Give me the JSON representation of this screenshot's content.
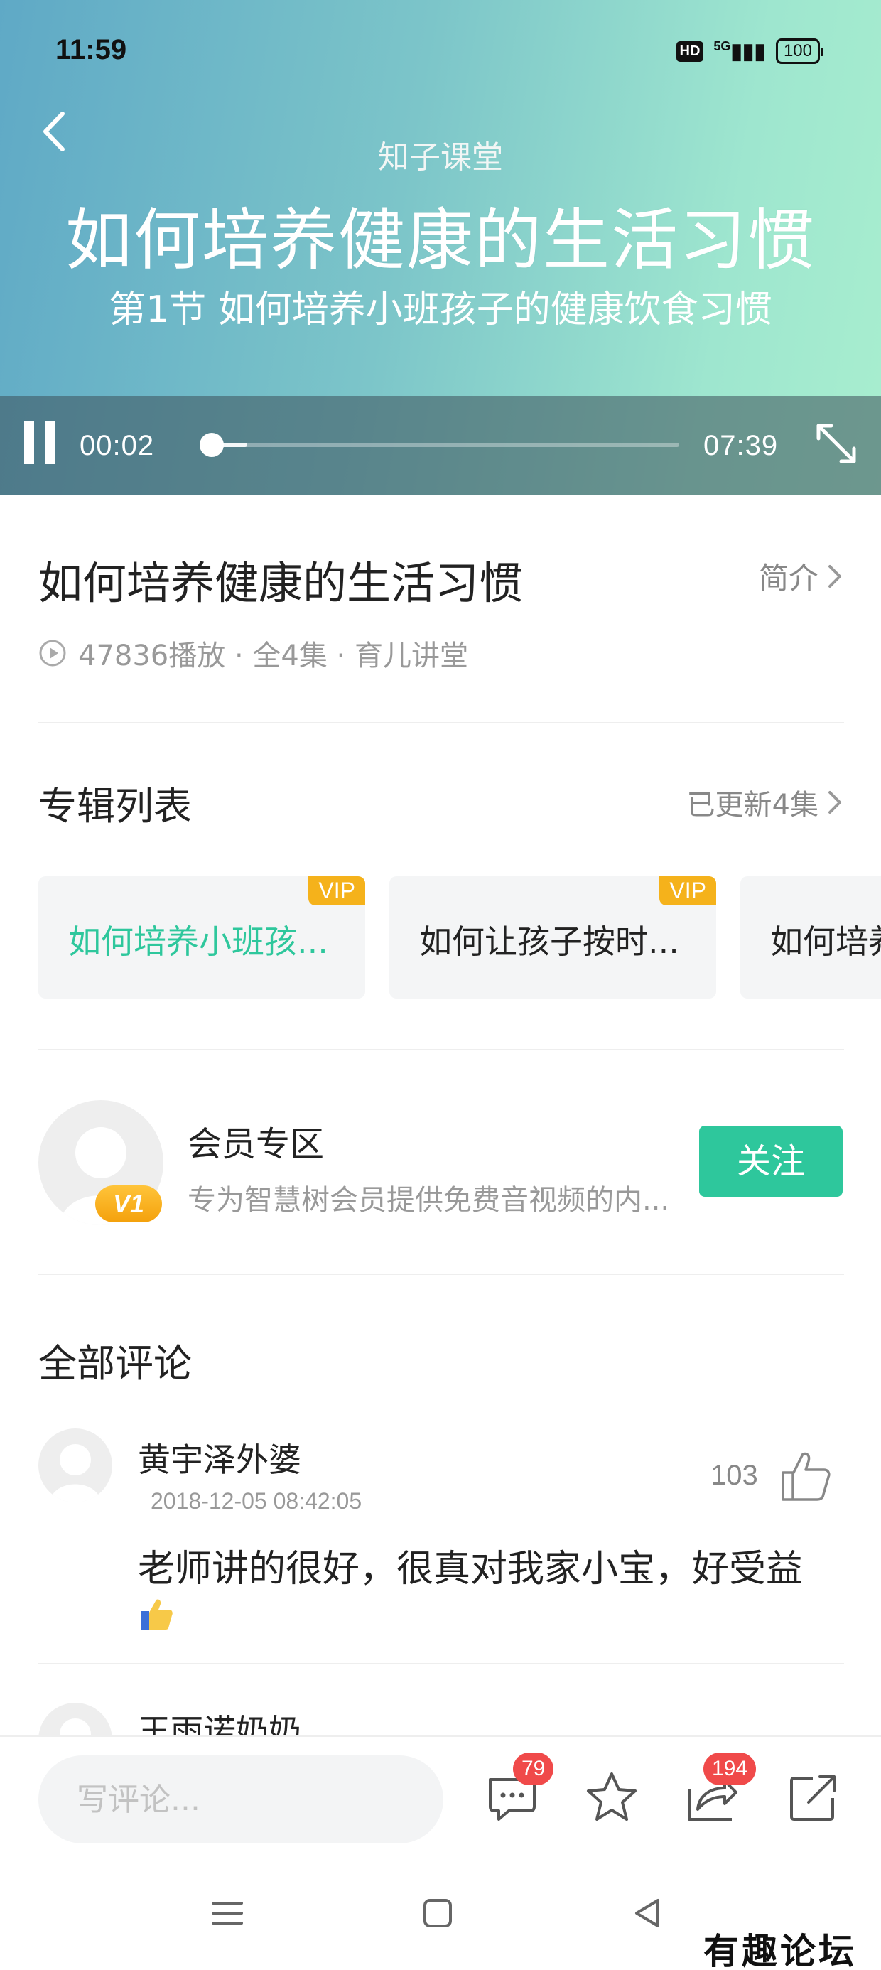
{
  "status_bar": {
    "time": "11:59",
    "hd": "HD",
    "network": "5G",
    "battery": "100"
  },
  "video": {
    "brand": "知子课堂",
    "title": "如何培养健康的生活习惯",
    "subtitle": "第1节 如何培养小班孩子的健康饮食习惯",
    "current_time": "00:02",
    "duration": "07:39",
    "progress_fraction": 0.004,
    "buffered_fraction": 0.09
  },
  "album": {
    "title": "如何培养健康的生活习惯",
    "intro_label": "简介",
    "meta": "47836播放 · 全4集 · 育儿讲堂"
  },
  "episodes": {
    "section_title": "专辑列表",
    "updated_label": "已更新4集",
    "items": [
      {
        "label": "如何培养小班孩...",
        "vip": "VIP",
        "active": true
      },
      {
        "label": "如何让孩子按时...",
        "vip": "VIP",
        "active": false
      },
      {
        "label": "如何培养",
        "vip": "",
        "active": false
      }
    ]
  },
  "member": {
    "badge": "V1",
    "name": "会员专区",
    "description": "专为智慧树会员提供免费音视频的内...",
    "follow_label": "关注"
  },
  "comments": {
    "section_title": "全部评论",
    "items": [
      {
        "user": "黄宇泽外婆",
        "date": "2018-12-05 08:42:05",
        "likes": "103",
        "text": "老师讲的很好，很真对我家小宝，好受益"
      },
      {
        "user": "王雨诺奶奶"
      }
    ]
  },
  "bottom_bar": {
    "placeholder": "写评论...",
    "comment_count": "79",
    "share_count": "194"
  },
  "watermark": "有趣论坛",
  "colors": {
    "accent": "#2ec79c",
    "vip": "#f5b21b",
    "badge": "#f04a4a"
  }
}
